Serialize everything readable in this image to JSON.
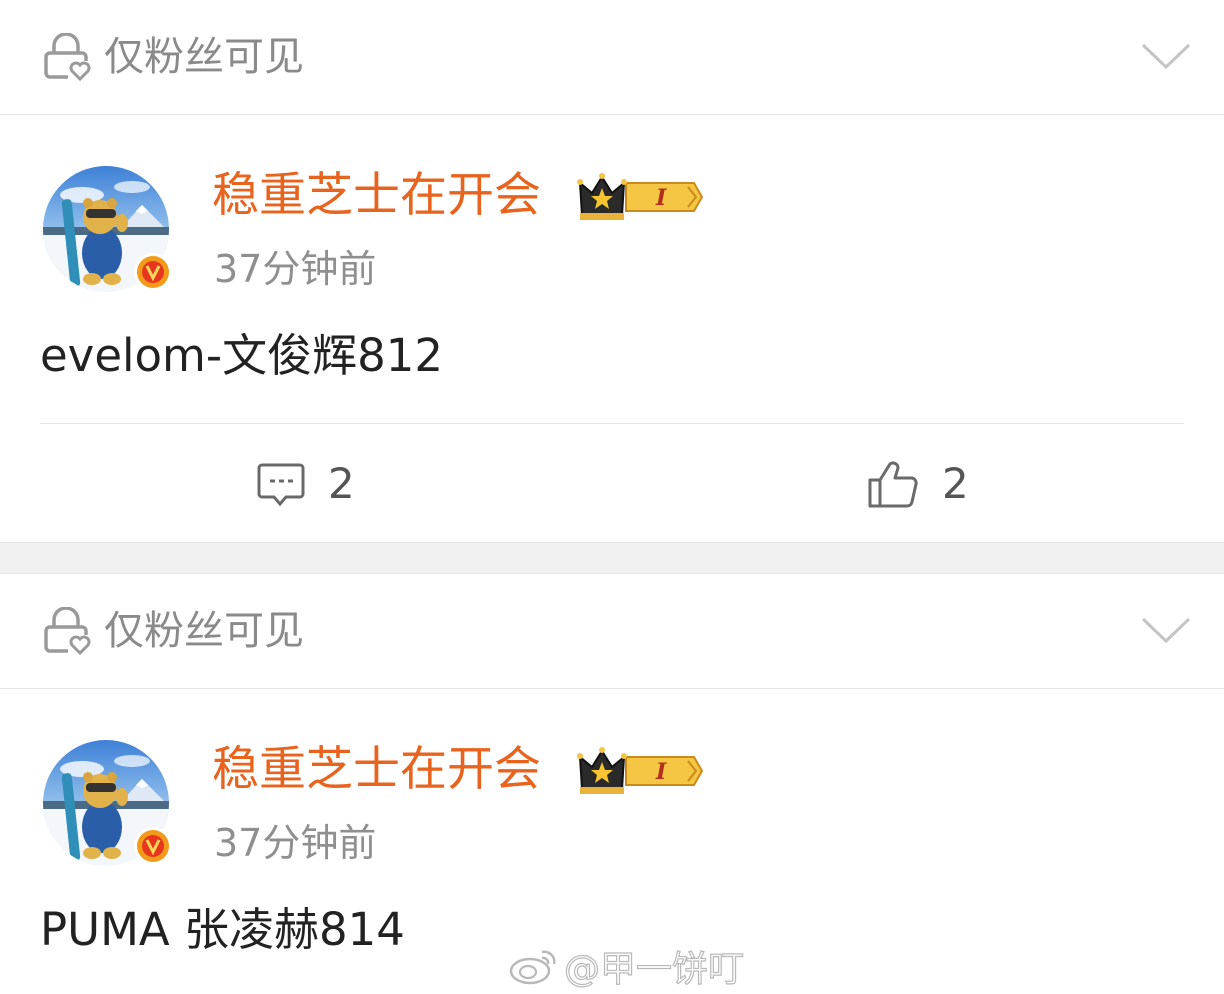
{
  "posts": [
    {
      "visibility_label": "仅粉丝可见",
      "username": "稳重芝士在开会",
      "level_badge": "I",
      "timestamp": "37分钟前",
      "text": "evelom-文俊辉812",
      "comment_count": "2",
      "like_count": "2"
    },
    {
      "visibility_label": "仅粉丝可见",
      "username": "稳重芝士在开会",
      "level_badge": "I",
      "timestamp": "37分钟前",
      "text": "PUMA 张凌赫814"
    }
  ],
  "watermark": "@甲一饼叮",
  "colors": {
    "username": "#e8631e",
    "verified_badge": "#f29a1a",
    "muted_text": "#8a8a8a",
    "body_text": "#222222"
  },
  "icons": {
    "visibility": "lock-heart-icon",
    "expand": "chevron-down-icon",
    "comment": "comment-icon",
    "like": "thumbs-up-icon",
    "verified": "verified-v-icon",
    "crown": "crown-icon",
    "weibo": "weibo-logo-icon"
  }
}
